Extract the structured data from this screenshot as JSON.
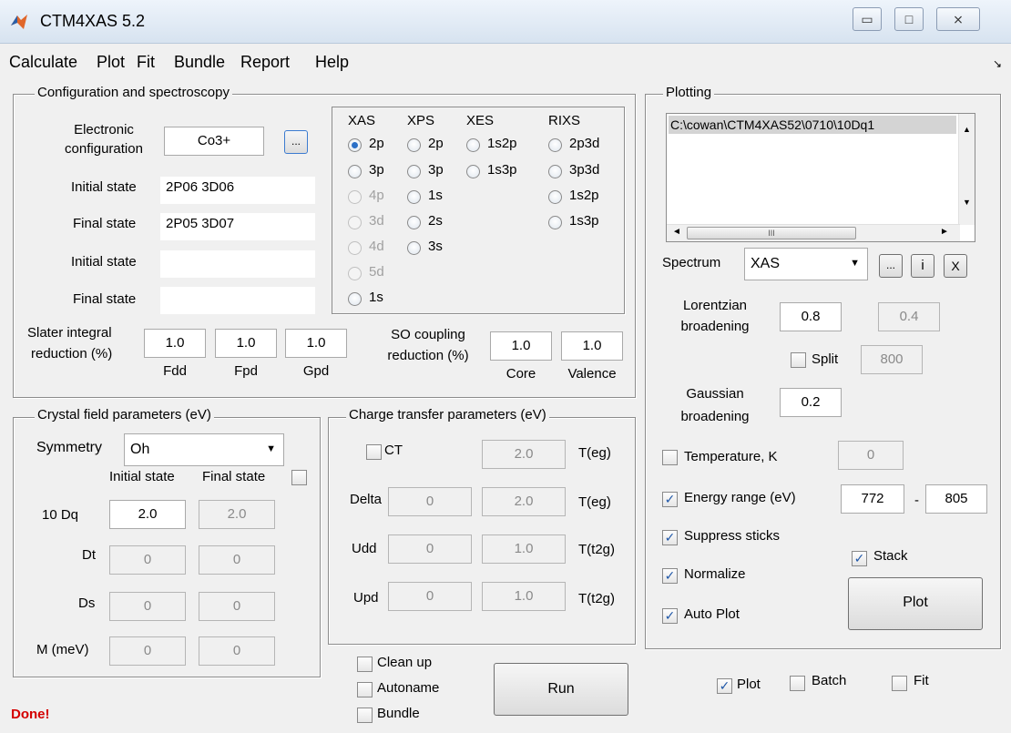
{
  "window": {
    "title": "CTM4XAS 5.2",
    "min_glyph": "▭",
    "max_glyph": "□",
    "close_glyph": "⨯"
  },
  "menu": [
    "Calculate",
    "Plot",
    "Fit",
    "Bundle",
    "Report",
    "Help"
  ],
  "menu_arrow": "↘",
  "config": {
    "title": "Configuration and spectroscopy",
    "electronic_label_1": "Electronic",
    "electronic_label_2": "configuration",
    "electronic_value": "Co3+",
    "browse_label": "...",
    "initial_state_label": "Initial state",
    "initial_state_value": "2P06 3D06",
    "final_state_label": "Final state",
    "final_state_value": "2P05 3D07",
    "initial_state2_label": "Initial state",
    "initial_state2_value": "",
    "final_state2_label": "Final state",
    "final_state2_value": "",
    "slater_label_1": "Slater integral",
    "slater_label_2": "reduction (%)",
    "fdd_value": "1.0",
    "fpd_value": "1.0",
    "gpd_value": "1.0",
    "fdd_label": "Fdd",
    "fpd_label": "Fpd",
    "gpd_label": "Gpd",
    "so_label_1": "SO coupling",
    "so_label_2": "reduction (%)",
    "core_value": "1.0",
    "valence_value": "1.0",
    "core_label": "Core",
    "valence_label": "Valence"
  },
  "spectroscopy": {
    "headers": {
      "xas": "XAS",
      "xps": "XPS",
      "xes": "XES",
      "rixs": "RIXS"
    },
    "xas": [
      "2p",
      "3p",
      "4p",
      "3d",
      "4d",
      "5d",
      "1s"
    ],
    "xps": [
      "2p",
      "3p",
      "1s",
      "2s",
      "3s"
    ],
    "xes": [
      "1s2p",
      "1s3p"
    ],
    "rixs": [
      "2p3d",
      "3p3d",
      "1s2p",
      "1s3p"
    ],
    "selected": "XAS 2p"
  },
  "crystal": {
    "title": "Crystal field parameters (eV)",
    "symmetry_label": "Symmetry",
    "symmetry_value": "Oh",
    "initial_header": "Initial state",
    "final_header": "Final state",
    "rows": [
      {
        "label": "10 Dq",
        "initial": "2.0",
        "final": "2.0"
      },
      {
        "label": "Dt",
        "initial": "0",
        "final": "0"
      },
      {
        "label": "Ds",
        "initial": "0",
        "final": "0"
      },
      {
        "label": "M (meV)",
        "initial": "0",
        "final": "0"
      }
    ]
  },
  "charge": {
    "title": "Charge transfer parameters (eV)",
    "ct_label": "CT",
    "ct_value": "2.0",
    "ct_unit": "T(eg)",
    "rows": [
      {
        "label": "Delta",
        "v1": "0",
        "v2": "2.0",
        "unit": "T(eg)"
      },
      {
        "label": "Udd",
        "v1": "0",
        "v2": "1.0",
        "unit": "T(t2g)"
      },
      {
        "label": "Upd",
        "v1": "0",
        "v2": "1.0",
        "unit": "T(t2g)"
      }
    ]
  },
  "run": {
    "clean_up": "Clean up",
    "autoname": "Autoname",
    "bundle": "Bundle",
    "run_button": "Run"
  },
  "plotting": {
    "title": "Plotting",
    "list_path": "C:\\cowan\\CTM4XAS52\\0710\\10Dq1",
    "spectrum_label": "Spectrum",
    "spectrum_value": "XAS",
    "btn_more": "...",
    "btn_info": "i",
    "btn_close": "X",
    "lorentzian_label_1": "Lorentzian",
    "lorentzian_label_2": "broadening",
    "lorentzian_value": "0.8",
    "lorentzian_value2": "0.4",
    "split_label": "Split",
    "split_value": "800",
    "gaussian_label_1": "Gaussian",
    "gaussian_label_2": "broadening",
    "gaussian_value": "0.2",
    "temperature_label": "Temperature, K",
    "temperature_value": "0",
    "energy_label": "Energy range (eV)",
    "energy_min": "772",
    "energy_dash": "-",
    "energy_max": "805",
    "suppress_label": "Suppress sticks",
    "stack_label": "Stack",
    "normalize_label": "Normalize",
    "autoplot_label": "Auto Plot",
    "plot_button": "Plot",
    "scroll_up": "▲",
    "scroll_down": "▼",
    "scroll_left": "◄",
    "scroll_right": "►",
    "scroll_thumb": "III"
  },
  "bottom": {
    "plot": "Plot",
    "batch": "Batch",
    "fit": "Fit"
  },
  "status": "Done!",
  "check": "✓"
}
